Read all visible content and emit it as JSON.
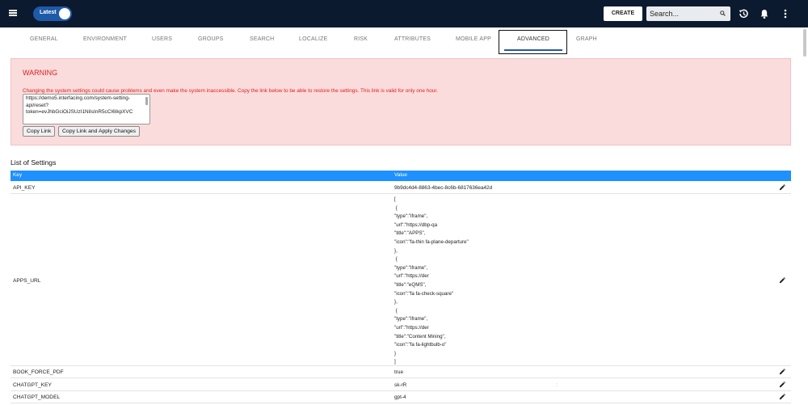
{
  "topbar": {
    "latest_label": "Latest",
    "create_label": "CREATE",
    "search_placeholder": "Search...",
    "icons": [
      "menu-icon",
      "search-icon",
      "history-icon",
      "bell-icon",
      "more-vert-icon"
    ]
  },
  "tabs": [
    {
      "label": "GENERAL"
    },
    {
      "label": "ENVIRONMENT"
    },
    {
      "label": "USERS"
    },
    {
      "label": "GROUPS"
    },
    {
      "label": "SEARCH"
    },
    {
      "label": "LOCALIZE"
    },
    {
      "label": "RISK"
    },
    {
      "label": "ATTRIBUTES"
    },
    {
      "label": "MOBILE APP"
    },
    {
      "label": "ADVANCED"
    },
    {
      "label": "GRAPH"
    }
  ],
  "active_tab": "ADVANCED",
  "warning": {
    "title": "WARNING",
    "message": "Changing the system settings could cause problems and even make the system inaccessible. Copy the link below to be able to restore the settings. This link is valid for only one hour.",
    "link_value": "https://demo5.interfacing.com/system-setting-api/reset?token=evJhbGciOiJSUzI1NiIsInR5cCI6IkpXVC",
    "copy_link_label": "Copy Link",
    "copy_apply_label": "Copy Link and Apply Changes"
  },
  "settings": {
    "title": "List of Settings",
    "columns": {
      "key": "Key",
      "value": "Value"
    },
    "rows": [
      {
        "key": "API_KEY",
        "value": "9b9dc4d4-8863-4bec-8c6b-6817636ea42d"
      },
      {
        "key": "APPS_URL",
        "value_lines": [
          "[",
          " {",
          "\"type\":\"iframe\",",
          "\"url\":\"https://dbp-qa",
          "\"title\":\"APPS\",",
          "\"icon\":\"fa-thin fa-plane-departure\"",
          "},",
          " {",
          "\"type\":\"iframe\",",
          "\"url\":\"https://der",
          "\"title\":\"eQMS\",",
          "\"icon\":\"fa fa-check-square\"",
          "},",
          " {",
          "\"type\":\"iframe\",",
          "\"url\":\"https://der",
          "\"title\":\"Content Mining\",",
          "\"icon\":\"fa fa-lightbulb-o\"",
          "}",
          "]"
        ]
      },
      {
        "key": "BOOK_FORCE_PDF",
        "value": "true"
      },
      {
        "key": "CHATGPT_KEY",
        "value": "sk-rR",
        "trailing": ":"
      },
      {
        "key": "CHATGPT_MODEL",
        "value": "gpt-4"
      }
    ]
  },
  "colors": {
    "topbar_bg": "#0b1a2e",
    "accent": "#1e5aa8",
    "table_header": "#1e90ff",
    "warning_bg": "#fadcdc",
    "warning_text": "#e02020"
  }
}
